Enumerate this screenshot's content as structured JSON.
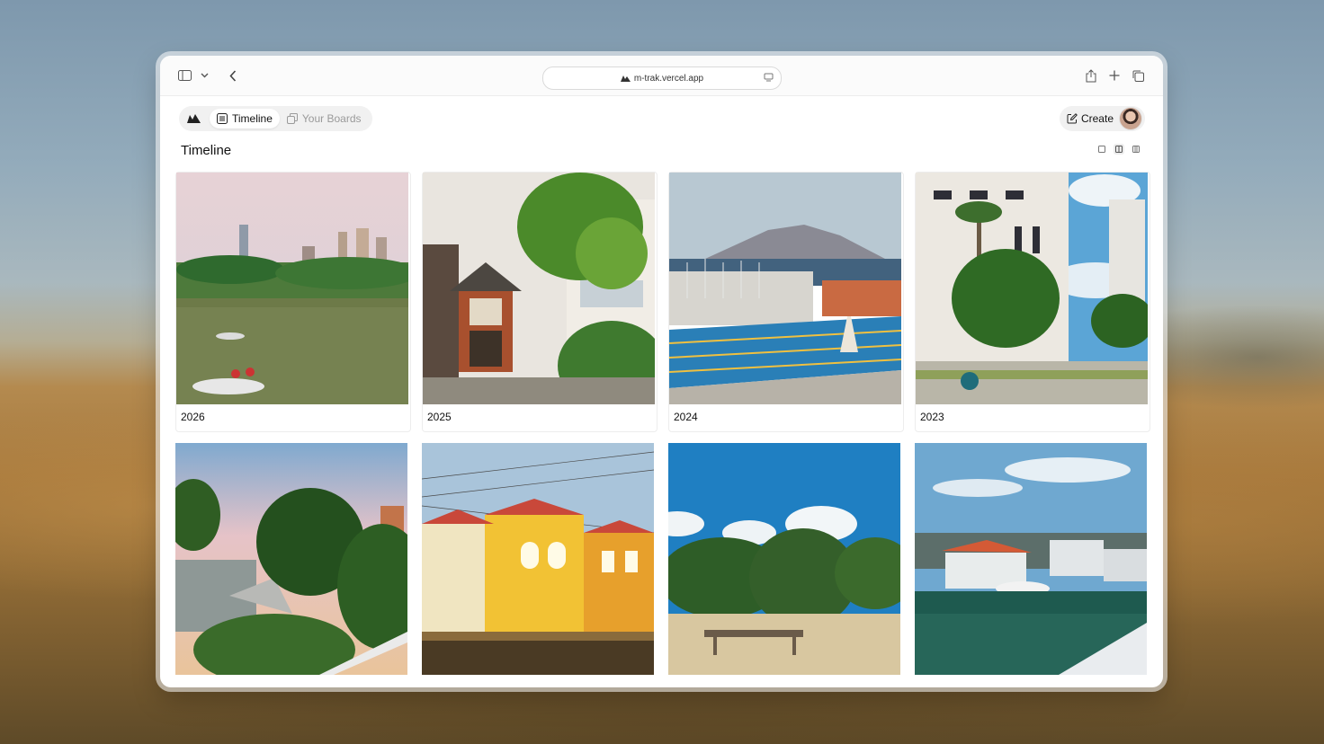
{
  "browser": {
    "url": "m-trak.vercel.app",
    "icons": [
      "sidebar-icon",
      "chevron-down-icon",
      "back-icon",
      "share-icon",
      "new-tab-icon",
      "tabs-overview-icon",
      "reader-icon"
    ]
  },
  "nav": {
    "tabs": [
      {
        "label": "Timeline",
        "icon": "list-icon",
        "active": true
      },
      {
        "label": "Your Boards",
        "icon": "boards-icon",
        "active": false
      }
    ],
    "create_label": "Create"
  },
  "page": {
    "title": "Timeline",
    "view_modes": [
      "single-column",
      "two-column",
      "three-column"
    ],
    "active_view": "two-column"
  },
  "timeline": [
    {
      "label": "2026",
      "scene": "city-park-lake"
    },
    {
      "label": "2025",
      "scene": "hanok-house"
    },
    {
      "label": "2024",
      "scene": "harbor-pool-volcano"
    },
    {
      "label": "2023",
      "scene": "apartment-palm"
    },
    {
      "label": "",
      "scene": "sunset-treetops"
    },
    {
      "label": "",
      "scene": "yellow-houses"
    },
    {
      "label": "",
      "scene": "picnic-trees"
    },
    {
      "label": "",
      "scene": "marina-boathouses"
    }
  ]
}
